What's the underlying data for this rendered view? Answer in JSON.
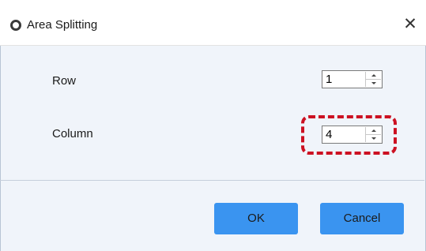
{
  "dialog": {
    "title": "Area Splitting",
    "close_symbol": "✕",
    "title_icon": "radio-circle-icon"
  },
  "fields": {
    "row": {
      "label": "Row",
      "value": "1"
    },
    "column": {
      "label": "Column",
      "value": "4"
    }
  },
  "buttons": {
    "ok_label": "OK",
    "cancel_label": "Cancel"
  },
  "colors": {
    "accent": "#3a94f0",
    "body_background": "#f0f4fa",
    "highlight": "#cc1122"
  }
}
